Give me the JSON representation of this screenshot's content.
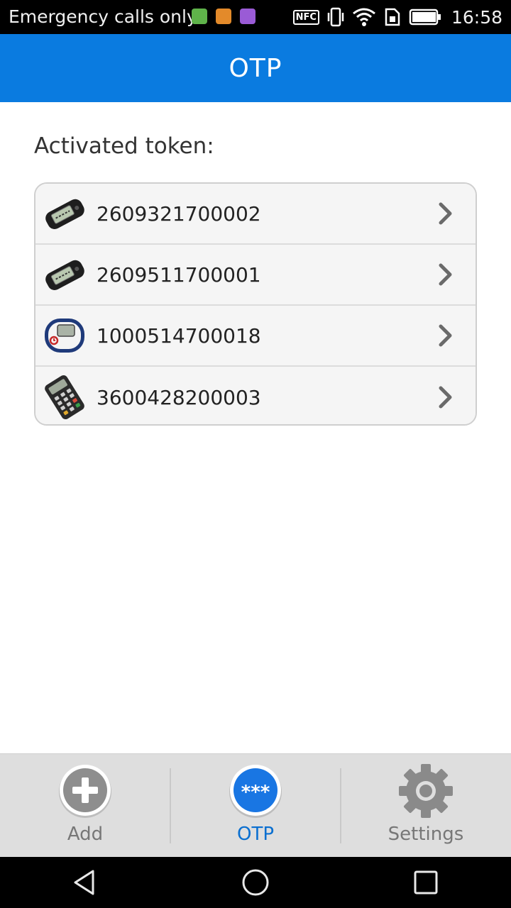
{
  "status_bar": {
    "carrier_text": "Emergency calls only",
    "nfc_label": "NFC",
    "time": "16:58",
    "notification_icons": [
      "app-notification-green-icon",
      "app-notification-orange-icon",
      "app-notification-purple-icon"
    ]
  },
  "app_bar": {
    "title": "OTP"
  },
  "main": {
    "section_label": "Activated token:",
    "tokens": [
      {
        "serial": "2609321700002",
        "icon": "display-token-icon"
      },
      {
        "serial": "2609511700001",
        "icon": "display-token-icon"
      },
      {
        "serial": "1000514700018",
        "icon": "keyfob-token-icon"
      },
      {
        "serial": "3600428200003",
        "icon": "calculator-token-icon"
      }
    ]
  },
  "tab_bar": {
    "tabs": [
      {
        "label": "Add",
        "icon": "add-icon",
        "active": false
      },
      {
        "label": "OTP",
        "icon": "otp-icon",
        "active": true
      },
      {
        "label": "Settings",
        "icon": "settings-gear-icon",
        "active": false
      }
    ]
  },
  "colors": {
    "primary": "#0a7be0",
    "active_tab": "#0a6fd0"
  }
}
